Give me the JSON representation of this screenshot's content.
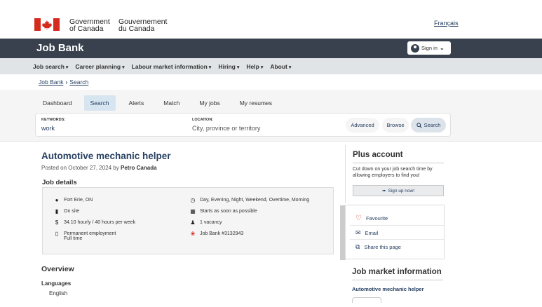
{
  "gc_header": {
    "signature_en_1": "Government",
    "signature_en_2": "of Canada",
    "signature_fr_1": "Gouvernement",
    "signature_fr_2": "du Canada",
    "language_link": "Français"
  },
  "brand_bar": {
    "title": "Job Bank",
    "signin_label": "Sign in"
  },
  "menu": [
    {
      "label": "Job search"
    },
    {
      "label": "Career planning"
    },
    {
      "label": "Labour market information"
    },
    {
      "label": "Hiring"
    },
    {
      "label": "Help"
    },
    {
      "label": "About"
    }
  ],
  "breadcrumb": [
    "Job Bank",
    "Search"
  ],
  "tabs": [
    {
      "label": "Dashboard"
    },
    {
      "label": "Search",
      "active": true
    },
    {
      "label": "Alerts"
    },
    {
      "label": "Match"
    },
    {
      "label": "My jobs"
    },
    {
      "label": "My resumes"
    }
  ],
  "search": {
    "keywords_label": "KEYWORDS:",
    "keywords_value": "work",
    "location_label": "LOCATION:",
    "location_placeholder": "City, province or territory",
    "advanced_label": "Advanced",
    "browse_label": "Browse",
    "search_label": "Search"
  },
  "job": {
    "title": "Automotive mechanic helper",
    "posted_prefix": "Posted on October 27, 2024 by",
    "employer": "Petro Canada",
    "details_heading": "Job details",
    "location": "Fort Erie, ON",
    "workplace": "On site",
    "salary": "34.10 hourly / 40 hours per week",
    "employment_line1": "Permanent employment",
    "employment_line2": "Full time",
    "schedule": "Day, Evening, Night, Weekend, Overtime, Morning",
    "start": "Starts as soon as possible",
    "vacancy": "1 vacancy",
    "job_bank_id": "Job Bank #3132943"
  },
  "overview": {
    "heading": "Overview",
    "languages_label": "Languages",
    "languages_value": "English"
  },
  "sidebar": {
    "plus_heading": "Plus account",
    "plus_text": "Cut down on your job search time by allowing employers to find you!",
    "signup_label": "Sign up now!",
    "favourite_label": "Favourite",
    "email_label": "Email",
    "share_label": "Share this page",
    "lmi_heading": "Job market information",
    "lmi_link": "Automotive mechanic helper"
  },
  "colors": {
    "brand_bar": "#38414d",
    "link": "#284162",
    "menu_bar": "#e1e4e7",
    "flag_red": "#d52b1e"
  }
}
